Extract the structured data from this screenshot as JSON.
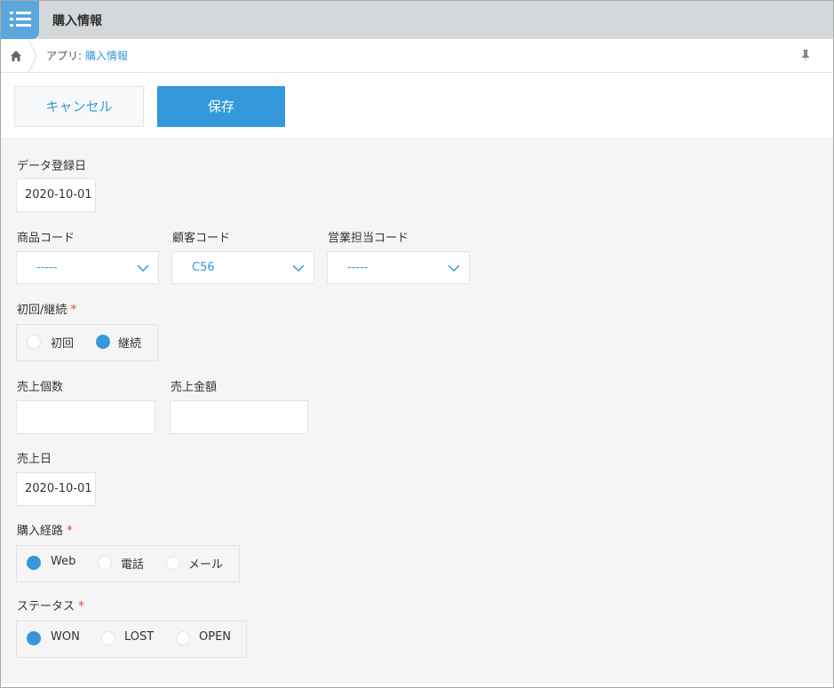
{
  "app": {
    "title": "購入情報",
    "breadcrumb_prefix": "アプリ: ",
    "breadcrumb_link": "購入情報"
  },
  "actions": {
    "cancel_label": "キャンセル",
    "save_label": "保存"
  },
  "form": {
    "data_date": {
      "label": "データ登録日",
      "value": "2020-10-01"
    },
    "product_code": {
      "label": "商品コード",
      "value": "-----"
    },
    "customer_code": {
      "label": "顧客コード",
      "value": "C56"
    },
    "sales_rep_code": {
      "label": "営業担当コード",
      "value": "-----"
    },
    "first_or_repeat": {
      "label": "初回/継続",
      "required_mark": "*",
      "options": [
        "初回",
        "継続"
      ],
      "selected": "継続"
    },
    "sales_qty": {
      "label": "売上個数",
      "value": ""
    },
    "sales_amount": {
      "label": "売上金額",
      "value": ""
    },
    "sales_date": {
      "label": "売上日",
      "value": "2020-10-01"
    },
    "purchase_channel": {
      "label": "購入経路",
      "required_mark": "*",
      "options": [
        "Web",
        "電話",
        "メール"
      ],
      "selected": "Web"
    },
    "status": {
      "label": "ステータス",
      "required_mark": "*",
      "options": [
        "WON",
        "LOST",
        "OPEN"
      ],
      "selected": "WON"
    }
  },
  "colors": {
    "accent": "#3498db",
    "required": "#e74c3c",
    "titlebar": "#d5d8da",
    "form_bg": "#f5f5f5"
  },
  "icons": [
    "app-list-icon",
    "home-icon",
    "pin-icon",
    "chevron-down-icon"
  ]
}
